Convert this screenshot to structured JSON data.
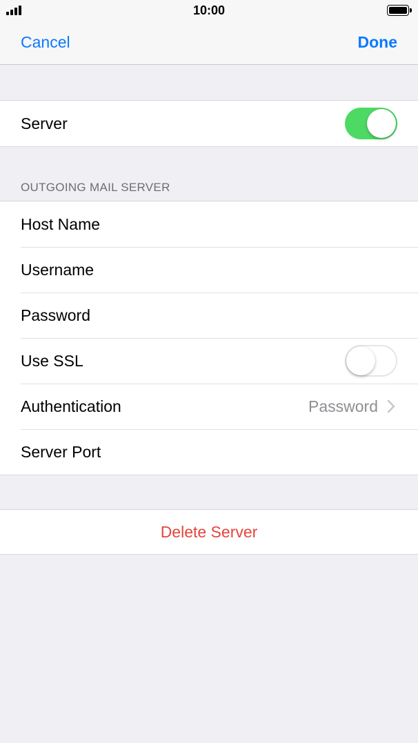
{
  "status_bar": {
    "time": "10:00",
    "signal_icon": "cellular-signal-icon",
    "battery_icon": "battery-icon",
    "battery_level": 1.0
  },
  "nav": {
    "cancel_label": "Cancel",
    "done_label": "Done"
  },
  "server_section": {
    "server_label": "Server",
    "server_enabled": true
  },
  "outgoing_section": {
    "header": "OUTGOING MAIL SERVER",
    "host_name_label": "Host Name",
    "username_label": "Username",
    "password_label": "Password",
    "use_ssl_label": "Use SSL",
    "use_ssl_enabled": false,
    "authentication_label": "Authentication",
    "authentication_value": "Password",
    "server_port_label": "Server Port"
  },
  "delete_section": {
    "delete_label": "Delete Server"
  },
  "colors": {
    "accent": "#0a7aff",
    "toggle_on": "#4cd964",
    "destructive": "#e5453b",
    "background": "#efeff4"
  }
}
